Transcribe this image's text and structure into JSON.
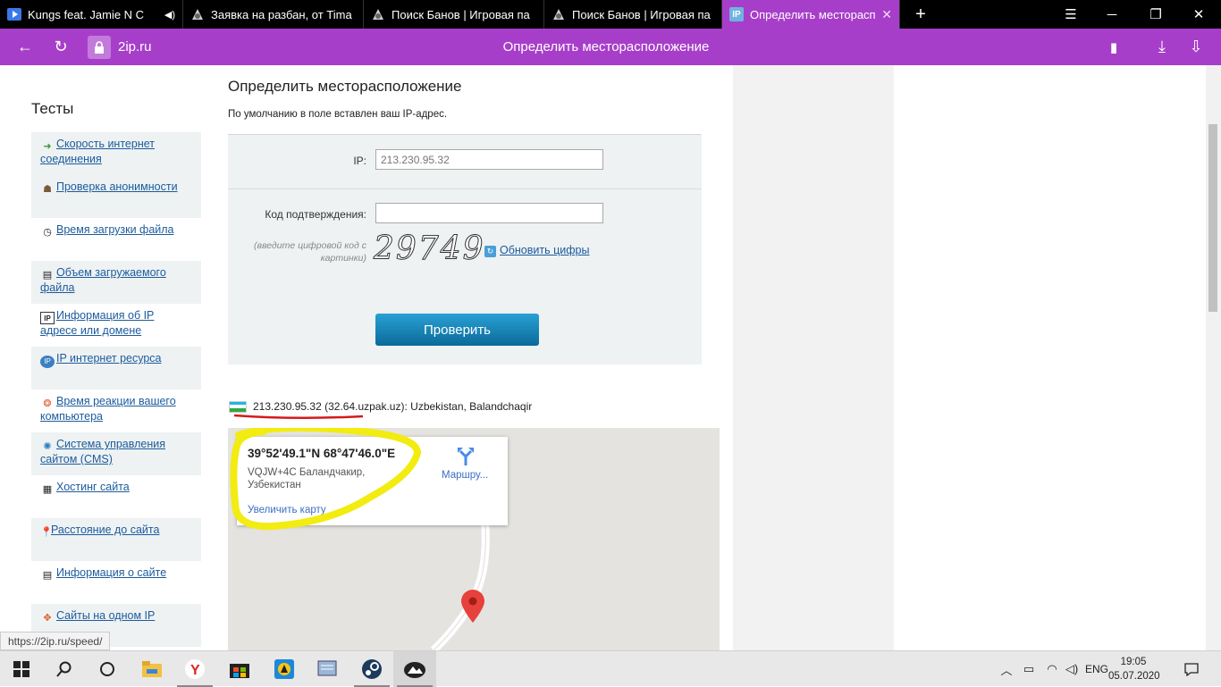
{
  "browser": {
    "tabs": [
      {
        "label": "Kungs feat. Jamie N C",
        "icon": "youtube-icon"
      },
      {
        "label": "Заявка на разбан, от Tima",
        "icon": "site-icon"
      },
      {
        "label": "Поиск Банов | Игровая па",
        "icon": "site-icon"
      },
      {
        "label": "Поиск Банов | Игровая па",
        "icon": "site-icon"
      },
      {
        "label": "Определить месторасполо",
        "icon": "ip-icon",
        "active": true
      }
    ],
    "url": "2ip.ru",
    "page_title": "Определить месторасположение",
    "accent_color": "#a73ec9",
    "status_url": "https://2ip.ru/speed/"
  },
  "sidebar": {
    "title": "Тесты",
    "items": [
      {
        "label": "Скорость интернет соединения",
        "icon": "speed-arrow-icon"
      },
      {
        "label": "Проверка анонимности",
        "icon": "spy-icon"
      },
      {
        "label": "Время загрузки файла",
        "icon": "clock-icon"
      },
      {
        "label": "Объем загружаемого файла",
        "icon": "file-icon"
      },
      {
        "label": "Информация об IP адресе или домене",
        "icon": "ip-info-icon"
      },
      {
        "label": "IP интернет ресурса",
        "icon": "ip-globe-icon"
      },
      {
        "label": "Время реакции вашего компьютера",
        "icon": "reaction-icon"
      },
      {
        "label": "Система управления сайтом (CMS)",
        "icon": "cms-icon"
      },
      {
        "label": "Хостинг сайта",
        "icon": "hosting-icon"
      },
      {
        "label": "Расстояние до сайта",
        "icon": "pin-icon"
      },
      {
        "label": "Информация о сайте",
        "icon": "site-info-icon"
      },
      {
        "label": "Сайты на одном IP",
        "icon": "sites-ip-icon"
      }
    ]
  },
  "main": {
    "title": "Определить месторасположение",
    "subtitle": "По умолчанию в поле вставлен ваш IP-адрес.",
    "form": {
      "ip_label": "IP:",
      "ip_value": "213.230.95.32",
      "code_label": "Код подтверждения:",
      "code_value": "",
      "hint": "(введите цифровой код с картинки)",
      "captcha": "29749",
      "refresh_label": "Обновить цифры",
      "submit_label": "Проверить"
    },
    "result": {
      "ip": "213.230.95.32",
      "host": "(32.64.uzpak.uz)",
      "location": ": Uzbekistan, Balandchaqir"
    },
    "map": {
      "coords": "39°52'49.1\"N 68°47'46.0\"E",
      "address": "VQJW+4C Баландчакир, Узбекистан",
      "enlarge_label": "Увеличить карту",
      "route_label": "Маршру..."
    }
  },
  "taskbar": {
    "apps": [
      "start-icon",
      "search-icon",
      "taskview-icon",
      "explorer-icon",
      "yandex-browser-icon",
      "store-icon",
      "app-icon",
      "notepad-icon",
      "steam-icon",
      "game-icon"
    ],
    "language": "ENG",
    "time": "19:05",
    "date": "05.07.2020"
  }
}
